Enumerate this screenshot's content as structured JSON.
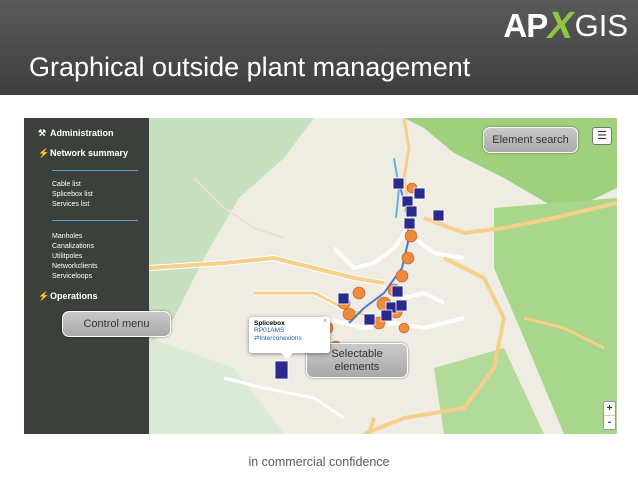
{
  "header": {
    "logo": {
      "ap": "AP",
      "x": "X",
      "gis": "GIS"
    },
    "title": "Graphical outside plant management"
  },
  "sidebar": {
    "administration": "Administration",
    "network_summary": "Network summary",
    "group1": [
      "Cable list",
      "Splicebox list",
      "Services list"
    ],
    "group2": [
      "Manholes",
      "Canalizations",
      "Utilitpoles",
      "Networkclients",
      "Serviceloops"
    ],
    "operations": "Operations"
  },
  "callouts": {
    "element_search": "Element search",
    "control_menu": "Control menu",
    "selectable_elements": "Selectable elements"
  },
  "popup": {
    "type": "Splicebox",
    "id": "RP01AMS",
    "link": "Interconexions",
    "close": "×"
  },
  "map_controls": {
    "zoom_in": "+",
    "zoom_out": "-"
  },
  "footer": "in commercial confidence",
  "colors": {
    "accent": "#8ec63f",
    "marker_square": "#2a2a8a",
    "marker_circle": "#ef8a3c",
    "road": "#f6cf8b"
  }
}
